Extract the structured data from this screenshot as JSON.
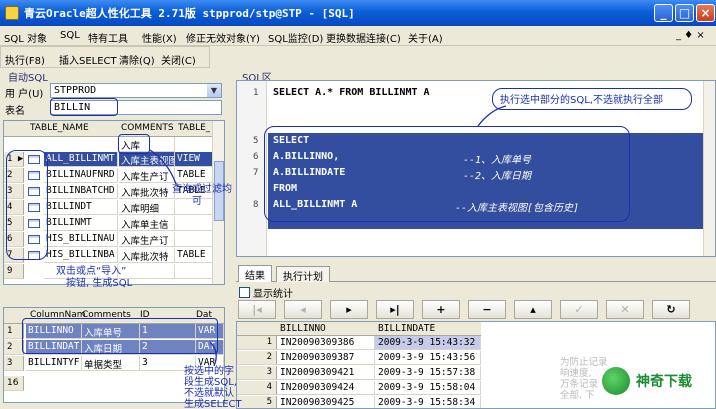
{
  "window": {
    "title": "青云Oracle超人性化工具 2.71版   stpprod/stp@STP - [SQL]"
  },
  "menubar": {
    "items": [
      "SQL 对象",
      "SQL",
      "特有工具",
      "性能(X)",
      "修正无效对象(Y)",
      "SQL监控(D)",
      "更换数据连接(C)",
      "关于(A)"
    ],
    "right_controls": "_ ♦ ×"
  },
  "toolbar": {
    "items": [
      "执行(F8)",
      "插入SELECT",
      "清除(Q)",
      "关闭(C)"
    ]
  },
  "left_panel": {
    "caption": "自动SQL",
    "user_label": "用 户(U)",
    "user_value": "STPPROD",
    "table_label": "表名",
    "table_value": "BILLIN",
    "tables_grid": {
      "columns": [
        "TABLE_NAME",
        "COMMENTS",
        "TABLE_"
      ],
      "filter_value": "入库",
      "rows": [
        {
          "n": "1",
          "name": "ALL_BILLINMT",
          "comment": "入库主表视图",
          "type": "VIEW"
        },
        {
          "n": "2",
          "name": "BILLINAUFNRD",
          "comment": "入库生产订",
          "type": "TABLE"
        },
        {
          "n": "3",
          "name": "BILLINBATCHD",
          "comment": "入库批次特",
          "type": "TABLE"
        },
        {
          "n": "4",
          "name": "BILLINDT",
          "comment": "入库明细",
          "type": ""
        },
        {
          "n": "5",
          "name": "BILLINMT",
          "comment": "入库单主信",
          "type": ""
        },
        {
          "n": "6",
          "name": "HIS_BILLINAU",
          "comment": "入库生产订",
          "type": ""
        },
        {
          "n": "7",
          "name": "HIS_BILLINBA",
          "comment": "入库批次特",
          "type": "TABLE"
        },
        {
          "n": "9",
          "name": "",
          "comment": "",
          "type": ""
        }
      ]
    },
    "columns_grid": {
      "columns": [
        "ColumnNam",
        "Comments",
        "ID",
        "Dat"
      ],
      "rows": [
        {
          "n": "1",
          "name": "BILLINNO",
          "comment": "入库单号",
          "id": "1",
          "type": "VAR"
        },
        {
          "n": "2",
          "name": "BILLINDAT",
          "comment": "入库日期",
          "id": "2",
          "type": "DAT"
        },
        {
          "n": "3",
          "name": "BILLINTYF",
          "comment": "单据类型",
          "id": "3",
          "type": "VAR"
        }
      ],
      "footer_num": "16"
    }
  },
  "editor": {
    "caption": "SQL区",
    "lines": [
      {
        "n": "1",
        "text": "SELECT A.* FROM BILLINMT A",
        "selected": false
      },
      {
        "n": "5",
        "text": "SELECT",
        "selected": true
      },
      {
        "n": "6",
        "text": "A.BILLINNO,",
        "selected": true,
        "comment": "--1、入库单号"
      },
      {
        "n": "7",
        "text": "A.BILLINDATE",
        "selected": true,
        "comment": "--2、入库日期"
      },
      {
        "n": "",
        "text": "FROM",
        "selected": true
      },
      {
        "n": "8",
        "text": "ALL_BILLINMT A",
        "selected": true,
        "comment": "--入库主表视图[包含历史]"
      }
    ]
  },
  "results": {
    "tabs": [
      "结果",
      "执行计划"
    ],
    "show_stats_label": "显示统计",
    "nav_buttons": [
      "|◂",
      "◂",
      "▸",
      "▸|",
      "+",
      "−",
      "▴",
      "✓",
      "✕",
      "↻"
    ],
    "columns": [
      "BILLINNO",
      "BILLINDATE"
    ],
    "rows": [
      {
        "n": "1",
        "no": "IN20090309386",
        "date": "2009-3-9 15:43:32",
        "current": true
      },
      {
        "n": "2",
        "no": "IN20090309387",
        "date": "2009-3-9 15:43:56",
        "current": false
      },
      {
        "n": "3",
        "no": "IN20090309421",
        "date": "2009-3-9 15:57:38",
        "current": false
      },
      {
        "n": "4",
        "no": "IN20090309424",
        "date": "2009-3-9 15:58:04",
        "current": false
      },
      {
        "n": "5",
        "no": "IN20090309425",
        "date": "2009-3-9 15:58:34",
        "current": false
      }
    ]
  },
  "annotations": {
    "editor_hint": "执行选中部分的SQL,不选就执行全部",
    "filter_hint_1": "查询或过滤均",
    "filter_hint_2": "可",
    "import_hint_1": "双击或点“导入”",
    "import_hint_2": "按钮, 生成SQL",
    "columns_hint_1": "按选中的字",
    "columns_hint_2": "段生成SQL,",
    "columns_hint_3": "不选就默认",
    "columns_hint_4": "生成SELECT",
    "watermark_1": "为防止记录",
    "watermark_2": "响速度,",
    "watermark_3": "万条记录",
    "watermark_4": "全部, 下",
    "brand": "神奇下载"
  }
}
